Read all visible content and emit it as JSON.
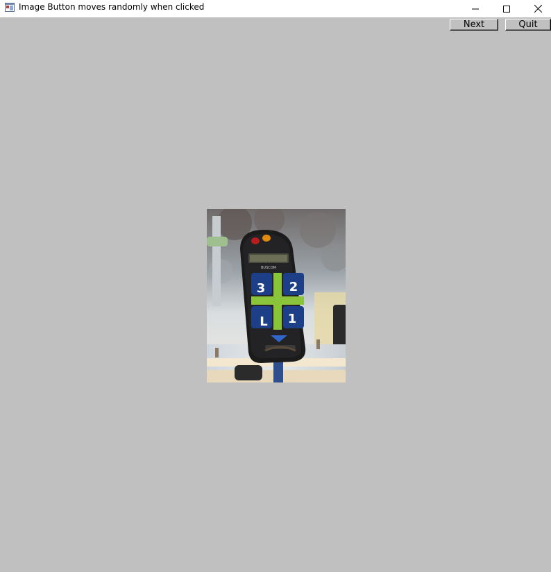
{
  "window": {
    "title": "Image Button moves randomly when clicked"
  },
  "toolbar": {
    "next_label": "Next",
    "quit_label": "Quit"
  },
  "image_button": {
    "photo_label": "BUSCOM",
    "keys": [
      "3",
      "2",
      "L",
      "1"
    ]
  }
}
